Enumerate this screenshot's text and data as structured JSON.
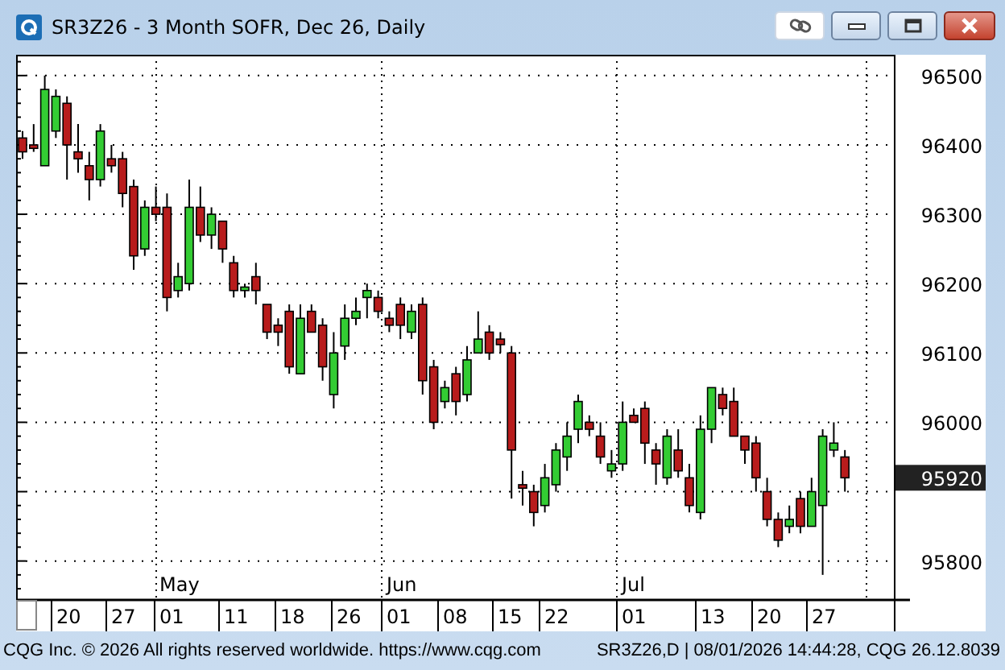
{
  "window": {
    "title": "SR3Z26 - 3 Month SOFR, Dec 26, Daily"
  },
  "chart": {
    "months": [
      "May",
      "Jun",
      "Jul"
    ],
    "days": [
      "20",
      "27",
      "01",
      "11",
      "18",
      "26",
      "01",
      "08",
      "15",
      "22",
      "01",
      "13",
      "20",
      "27"
    ],
    "last_price": "95920",
    "chart_data": {
      "type": "candlestick",
      "yticks": [
        96500,
        96400,
        96300,
        96200,
        96100,
        96000,
        95800
      ],
      "ylim": [
        95745,
        96530
      ],
      "grid": true,
      "ohlc": [
        [
          96410,
          96420,
          96380,
          96390
        ],
        [
          96400,
          96430,
          96390,
          96395
        ],
        [
          96370,
          96500,
          96370,
          96480
        ],
        [
          96420,
          96480,
          96410,
          96470
        ],
        [
          96460,
          96470,
          96350,
          96400
        ],
        [
          96390,
          96430,
          96360,
          96380
        ],
        [
          96370,
          96390,
          96320,
          96350
        ],
        [
          96350,
          96430,
          96340,
          96420
        ],
        [
          96380,
          96400,
          96360,
          96370
        ],
        [
          96380,
          96390,
          96310,
          96330
        ],
        [
          96340,
          96350,
          96220,
          96240
        ],
        [
          96250,
          96320,
          96240,
          96310
        ],
        [
          96310,
          96340,
          96290,
          96300
        ],
        [
          96310,
          96330,
          96160,
          96180
        ],
        [
          96190,
          96230,
          96180,
          96210
        ],
        [
          96200,
          96350,
          96190,
          96310
        ],
        [
          96310,
          96340,
          96260,
          96270
        ],
        [
          96270,
          96310,
          96250,
          96300
        ],
        [
          96290,
          96290,
          96230,
          96250
        ],
        [
          96230,
          96240,
          96180,
          96190
        ],
        [
          96190,
          96200,
          96180,
          96195
        ],
        [
          96210,
          96230,
          96170,
          96190
        ],
        [
          96170,
          96170,
          96120,
          96130
        ],
        [
          96140,
          96150,
          96110,
          96130
        ],
        [
          96160,
          96170,
          96070,
          96080
        ],
        [
          96070,
          96170,
          96070,
          96150
        ],
        [
          96160,
          96170,
          96130,
          96130
        ],
        [
          96140,
          96150,
          96060,
          96080
        ],
        [
          96040,
          96130,
          96020,
          96100
        ],
        [
          96110,
          96170,
          96090,
          96150
        ],
        [
          96150,
          96180,
          96140,
          96160
        ],
        [
          96180,
          96200,
          96150,
          96190
        ],
        [
          96180,
          96190,
          96150,
          96160
        ],
        [
          96150,
          96160,
          96130,
          96140
        ],
        [
          96170,
          96180,
          96120,
          96140
        ],
        [
          96130,
          96170,
          96120,
          96160
        ],
        [
          96170,
          96180,
          96040,
          96060
        ],
        [
          96080,
          96090,
          95990,
          96000
        ],
        [
          96030,
          96060,
          96020,
          96050
        ],
        [
          96070,
          96080,
          96010,
          96030
        ],
        [
          96040,
          96110,
          96030,
          96090
        ],
        [
          96100,
          96160,
          96100,
          96120
        ],
        [
          96130,
          96140,
          96090,
          96100
        ],
        [
          96120,
          96130,
          96100,
          96112
        ],
        [
          96100,
          96110,
          95890,
          95960
        ],
        [
          95910,
          95930,
          95880,
          95905
        ],
        [
          95900,
          95910,
          95850,
          95870
        ],
        [
          95880,
          95940,
          95870,
          95920
        ],
        [
          95910,
          95970,
          95900,
          95960
        ],
        [
          95950,
          96000,
          95930,
          95980
        ],
        [
          95990,
          96040,
          95970,
          96030
        ],
        [
          96000,
          96010,
          95980,
          95990
        ],
        [
          95980,
          96000,
          95940,
          95950
        ],
        [
          95930,
          95960,
          95920,
          95940
        ],
        [
          95940,
          96030,
          95930,
          96000
        ],
        [
          96010,
          96020,
          96000,
          96000
        ],
        [
          96020,
          96030,
          95940,
          95970
        ],
        [
          95960,
          95970,
          95910,
          95940
        ],
        [
          95920,
          95990,
          95910,
          95980
        ],
        [
          95960,
          95990,
          95920,
          95930
        ],
        [
          95920,
          95940,
          95870,
          95880
        ],
        [
          95870,
          96010,
          95860,
          95990
        ],
        [
          95990,
          96050,
          95970,
          96050
        ],
        [
          96040,
          96050,
          96010,
          96020
        ],
        [
          96030,
          96050,
          95980,
          95980
        ],
        [
          95980,
          95980,
          95940,
          95960
        ],
        [
          95970,
          95980,
          95900,
          95920
        ],
        [
          95900,
          95920,
          95850,
          95860
        ],
        [
          95860,
          95870,
          95820,
          95830
        ],
        [
          95850,
          95880,
          95840,
          95860
        ],
        [
          95890,
          95900,
          95840,
          95850
        ],
        [
          95850,
          95920,
          95850,
          95900
        ],
        [
          95880,
          95990,
          95780,
          95980
        ],
        [
          95960,
          96000,
          95950,
          95970
        ],
        [
          95950,
          95960,
          95900,
          95920
        ]
      ]
    }
  },
  "status_bar": {
    "left": "CQG Inc. © 2026 All rights reserved worldwide. https://www.cqg.com",
    "right": "SR3Z26,D | 08/01/2026 14:44:28, CQG 26.12.8039"
  }
}
